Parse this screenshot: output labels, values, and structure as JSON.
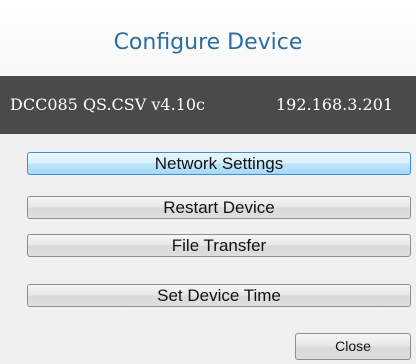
{
  "dialog": {
    "title": "Configure Device"
  },
  "device": {
    "name": "DCC085 QS.CSV v4.10c",
    "ip": "192.168.3.201"
  },
  "actions": {
    "network_settings": "Network Settings",
    "restart_device": "Restart Device",
    "file_transfer": "File Transfer",
    "set_device_time": "Set Device Time"
  },
  "footer": {
    "close_label": "Close"
  },
  "colors": {
    "title": "#2d6ea0",
    "info_bar": "#4a4a4a",
    "focused_button_border": "#3b8fd4"
  }
}
